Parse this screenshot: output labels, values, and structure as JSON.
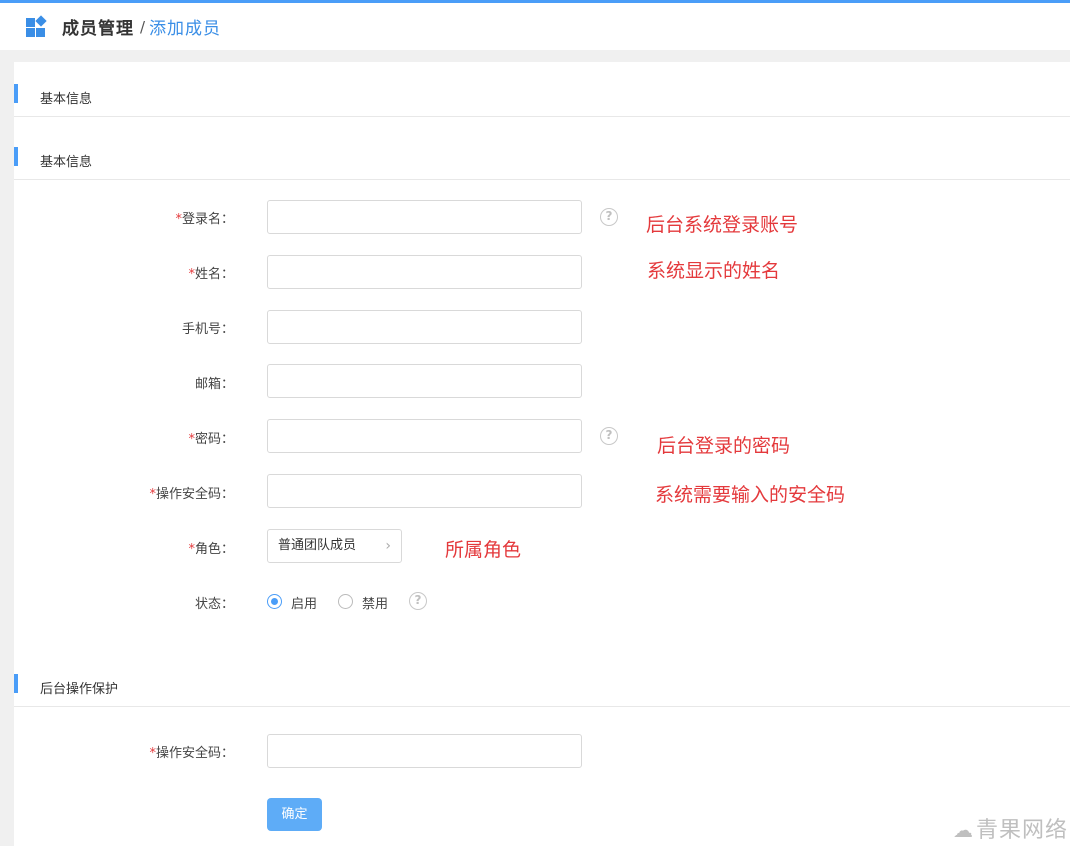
{
  "header": {
    "crumb_main": "成员管理",
    "crumb_sep": "/",
    "crumb_sub": "添加成员"
  },
  "sections": {
    "s1": "基本信息",
    "s2": "基本信息",
    "s3": "后台操作保护"
  },
  "form": {
    "required_mark": "*",
    "login_label": "登录名：",
    "name_label": "姓名：",
    "phone_label": "手机号：",
    "email_label": "邮箱：",
    "password_label": "密码：",
    "safecode_label": "操作安全码：",
    "role_label": "角色：",
    "role_value": "普通团队成员",
    "status_label": "状态：",
    "status_on": "启用",
    "status_off": "禁用",
    "protect_safecode_label": "操作安全码：",
    "submit": "确定",
    "help_glyph": "?"
  },
  "notes": {
    "login": "后台系统登录账号",
    "name": "系统显示的姓名",
    "password": "后台登录的密码",
    "safecode": "系统需要输入的安全码",
    "role": "所属角色"
  },
  "watermark": "青果网络",
  "colors": {
    "accent": "#4a9df8",
    "annotation": "#e4393c"
  }
}
